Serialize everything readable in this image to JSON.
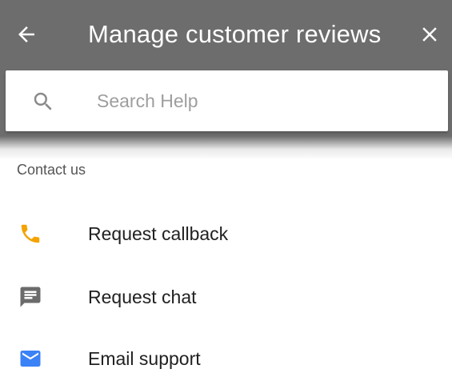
{
  "header": {
    "title": "Manage customer reviews",
    "back_icon": "arrow-back-icon",
    "close_icon": "close-icon",
    "background": "#6d6d6d"
  },
  "search": {
    "placeholder": "Search Help",
    "value": "",
    "icon": "search-icon"
  },
  "contact": {
    "section_title": "Contact us",
    "options": [
      {
        "label": "Request callback",
        "icon": "phone-icon",
        "icon_color": "#f4a300"
      },
      {
        "label": "Request chat",
        "icon": "chat-icon",
        "icon_color": "#6b6b6b"
      },
      {
        "label": "Email support",
        "icon": "email-icon",
        "icon_color": "#3b82f6"
      }
    ]
  }
}
